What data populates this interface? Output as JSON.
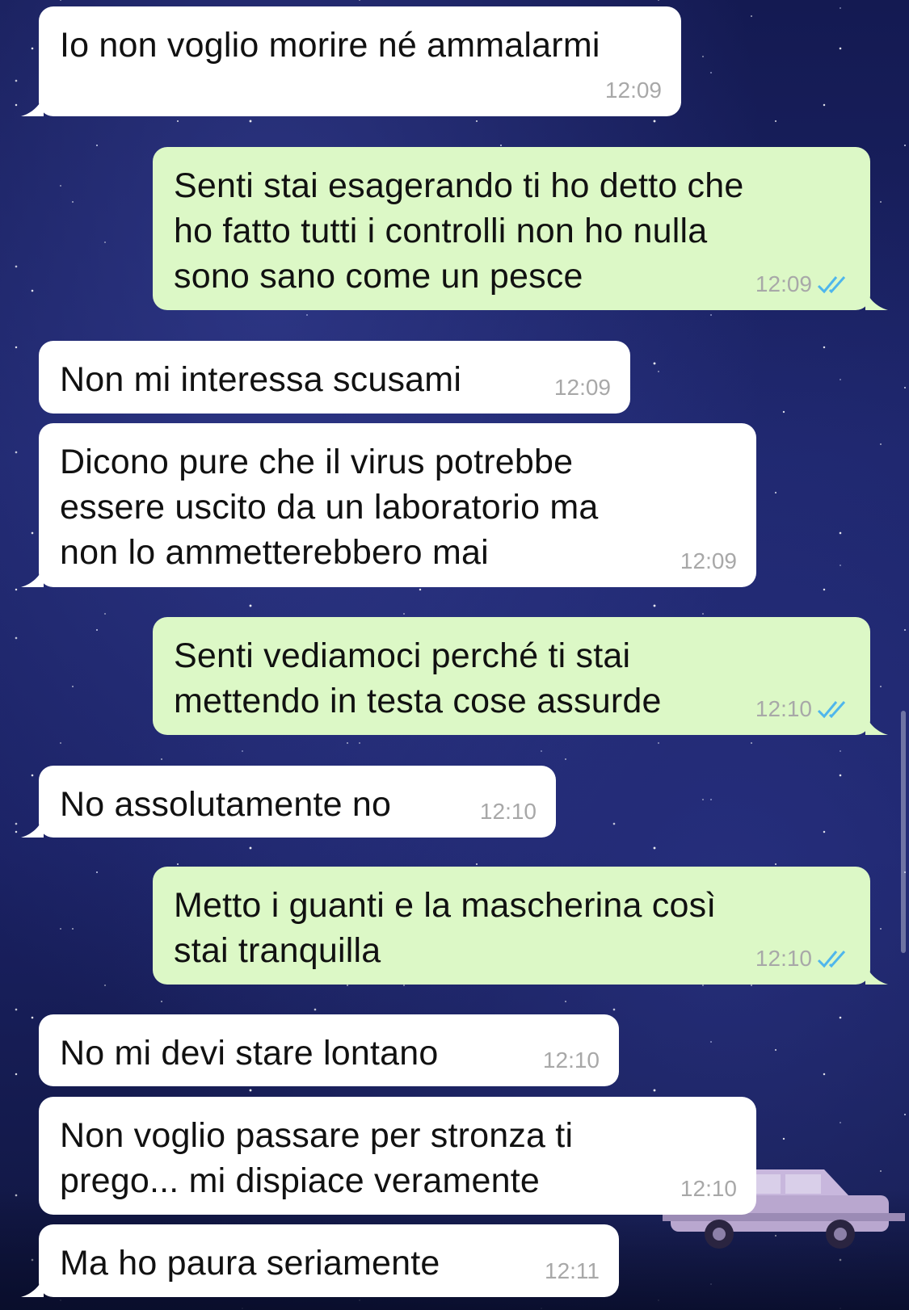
{
  "colors": {
    "incoming_bubble": "#ffffff",
    "outgoing_bubble": "#dcf8c6",
    "timestamp": "#a8a8a8",
    "read_ticks": "#4fb6ec"
  },
  "messages": [
    {
      "direction": "in",
      "text": "Io non voglio morire né ammalarmi",
      "time": "12:09"
    },
    {
      "direction": "out",
      "text": "Senti stai esagerando ti ho detto che\nho fatto tutti i controlli non ho nulla\nsono sano come un pesce",
      "time": "12:09",
      "status": "read"
    },
    {
      "direction": "in",
      "text": "Non mi interessa scusami",
      "time": "12:09"
    },
    {
      "direction": "in",
      "text": "Dicono pure che il virus potrebbe\nessere uscito da un laboratorio ma\nnon lo ammetterebbero mai",
      "time": "12:09"
    },
    {
      "direction": "out",
      "text": "Senti vediamoci perché ti stai\nmettendo in testa cose assurde",
      "time": "12:10",
      "status": "read"
    },
    {
      "direction": "in",
      "text": "No assolutamente no",
      "time": "12:10"
    },
    {
      "direction": "out",
      "text": "Metto i guanti e la mascherina così\nstai tranquilla",
      "time": "12:10",
      "status": "read"
    },
    {
      "direction": "in",
      "text": "No mi devi stare lontano",
      "time": "12:10"
    },
    {
      "direction": "in",
      "text": "Non voglio passare per stronza ti\nprego... mi dispiace veramente",
      "time": "12:10"
    },
    {
      "direction": "in",
      "text": "Ma ho paura seriamente",
      "time": "12:11"
    }
  ]
}
